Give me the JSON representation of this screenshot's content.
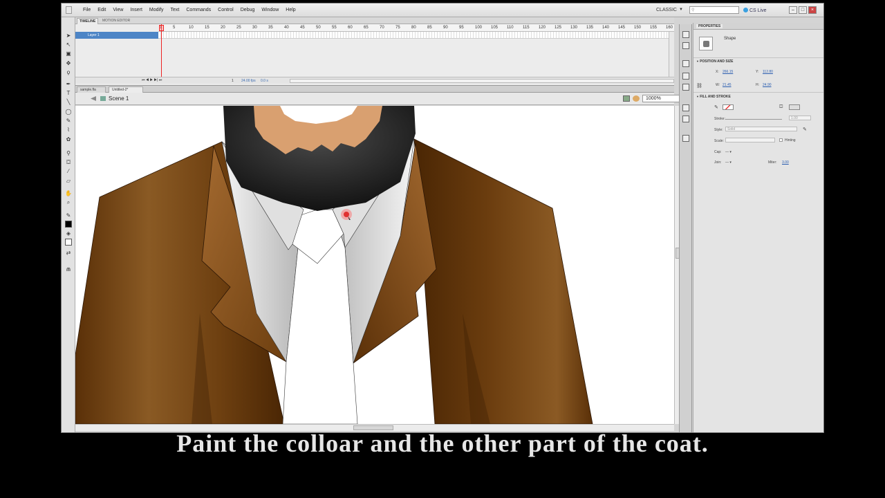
{
  "menubar": {
    "items": [
      "File",
      "Edit",
      "View",
      "Insert",
      "Modify",
      "Text",
      "Commands",
      "Control",
      "Debug",
      "Window",
      "Help"
    ],
    "workspace": "CLASSIC",
    "search_placeholder": "",
    "cslive": "CS Live",
    "window_buttons": {
      "minimize": "–",
      "maximize": "□",
      "close": "×"
    }
  },
  "timeline": {
    "tab_timeline": "TIMELINE",
    "tab_motion_editor": "MOTION EDITOR",
    "layer_name": "Layer 1",
    "frame_numbers": [
      "1",
      "5",
      "10",
      "15",
      "20",
      "25",
      "30",
      "35",
      "40",
      "45",
      "50",
      "55",
      "60",
      "65",
      "70",
      "75",
      "80",
      "85",
      "90",
      "95",
      "100",
      "105",
      "110",
      "115",
      "120",
      "125",
      "130",
      "135",
      "140",
      "145",
      "150",
      "155",
      "160"
    ],
    "current_frame": "1",
    "fps": "24.00 fps",
    "time": "0.0 s"
  },
  "documents": {
    "tabs": [
      "sample.fla",
      "Untitled-2*"
    ]
  },
  "editbar": {
    "scene": "Scene 1",
    "zoom": "1000%"
  },
  "properties": {
    "tab_label": "PROPERTIES",
    "instance_type": "Shape",
    "position_section": "POSITION AND SIZE",
    "x_label": "X:",
    "x_value": "266.15",
    "y_label": "Y:",
    "y_value": "112.80",
    "w_label": "W:",
    "w_value": "21.45",
    "h_label": "H:",
    "h_value": "24.90",
    "fill_section": "FILL AND STROKE",
    "stroke_label": "Stroke:",
    "stroke_value": "1.00",
    "style_label": "Style:",
    "style_value": "Solid",
    "scale_label": "Scale:",
    "hinting_label": "Hinting",
    "cap_label": "Cap:",
    "join_label": "Join:",
    "miter_label": "Miter:",
    "miter_value": "3.00"
  },
  "caption": "Paint the colloar and the other part of the coat."
}
